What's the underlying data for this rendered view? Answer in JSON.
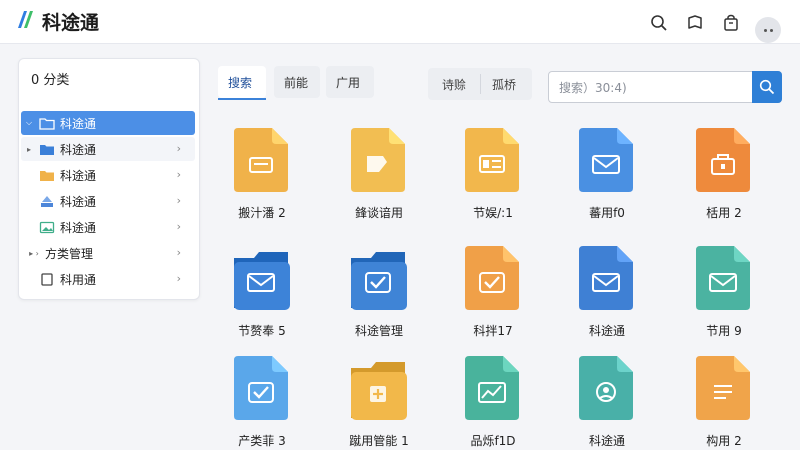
{
  "app": {
    "title": "科途通",
    "logo_colors": [
      "#2f7de1",
      "#3fbf6a"
    ]
  },
  "topbar_icons": [
    "search-icon",
    "bell-icon",
    "bag-icon",
    "more-icon"
  ],
  "sidebar": {
    "header": "0 分类",
    "items": [
      {
        "label": "科途通",
        "arrow": "⌵",
        "icon": "folder-outline-icon",
        "active": true
      },
      {
        "label": "科途通",
        "arrow": "▸",
        "icon": "folder-icon",
        "chevron": "›"
      },
      {
        "label": "科途通",
        "arrow": "",
        "icon": "folder-icon",
        "chevron": "›"
      },
      {
        "label": "科途通",
        "arrow": "",
        "icon": "network-icon",
        "chevron": "›"
      },
      {
        "label": "科途通",
        "arrow": "",
        "icon": "image-icon",
        "chevron": "›"
      },
      {
        "label": "方类管理",
        "arrow": "▸ ›",
        "icon": "",
        "chevron": "›"
      },
      {
        "label": "科用通",
        "arrow": "",
        "icon": "square-icon",
        "chevron": "›"
      }
    ]
  },
  "tabs": [
    {
      "label": "搜索",
      "active": true
    },
    {
      "label": "前能"
    },
    {
      "label": "广用"
    }
  ],
  "filters": [
    "诗赊",
    "孤桥"
  ],
  "search": {
    "placeholder": "搜索）30:4)"
  },
  "files": [
    {
      "label": "搬汁潘 2",
      "icon": "document-icon",
      "color": "#f0b24a"
    },
    {
      "label": "鋒谈谙用",
      "icon": "edit-document-icon",
      "color": "#f2be52"
    },
    {
      "label": "节娱/:1",
      "icon": "card-document-icon",
      "color": "#f2b74c"
    },
    {
      "label": "蕃用f0",
      "icon": "mail-document-icon",
      "color": "#4a90e2"
    },
    {
      "label": "栝用 2",
      "icon": "briefcase-document-icon",
      "color": "#ee8a3c"
    },
    {
      "label": "节赘奉 5",
      "icon": "mail-folder-icon",
      "color": "#3d83d8"
    },
    {
      "label": "科途管理",
      "icon": "check-folder-icon",
      "color": "#3f84d6"
    },
    {
      "label": "科拌17",
      "icon": "check-document-icon",
      "color": "#f0a048"
    },
    {
      "label": "科途通",
      "icon": "mail-document-icon",
      "color": "#3f80d4"
    },
    {
      "label": "节用 9",
      "icon": "mail-document-icon",
      "color": "#4bb3a1"
    },
    {
      "label": "产类菲 3",
      "icon": "check-document-icon",
      "color": "#5aa7ea"
    },
    {
      "label": "蹴用管能 1",
      "icon": "plus-folder-icon",
      "color": "#f2b84a"
    },
    {
      "label": "品烁f1D",
      "icon": "chart-document-icon",
      "color": "#49b39c"
    },
    {
      "label": "科途通",
      "icon": "person-document-icon",
      "color": "#49b0a8"
    },
    {
      "label": "构用 2",
      "icon": "list-document-icon",
      "color": "#f0a44a"
    }
  ]
}
